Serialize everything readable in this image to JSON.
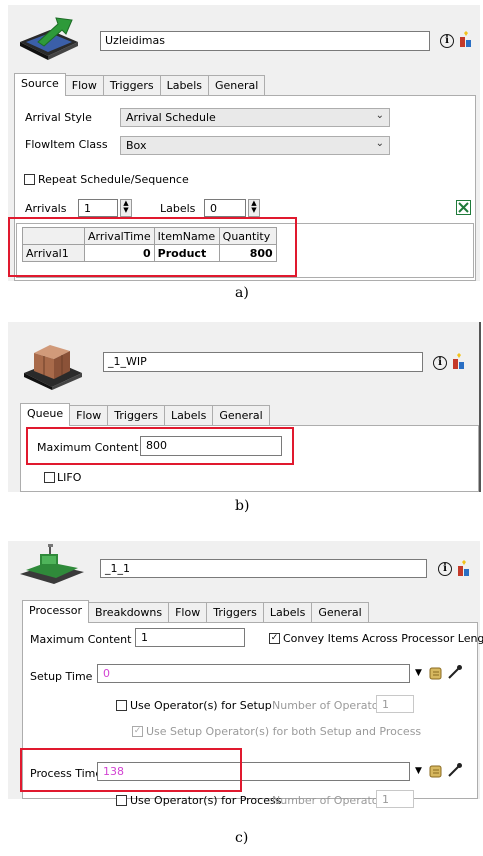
{
  "panel_a": {
    "object_name": "Uzleidimas",
    "tabs": [
      "Source",
      "Flow",
      "Triggers",
      "Labels",
      "General"
    ],
    "arrival_style_label": "Arrival Style",
    "arrival_style_value": "Arrival Schedule",
    "flowitem_class_label": "FlowItem Class",
    "flowitem_class_value": "Box",
    "repeat_label": "Repeat Schedule/Sequence",
    "arrivals_label": "Arrivals",
    "arrivals_value": "1",
    "labels_label": "Labels",
    "labels_value": "0",
    "table": {
      "columns": [
        "ArrivalTime",
        "ItemName",
        "Quantity"
      ],
      "rows": [
        {
          "name": "Arrival1",
          "time": "0",
          "item": "Product",
          "qty": "800"
        }
      ]
    },
    "caption": "a)"
  },
  "panel_b": {
    "object_name": "_1_WIP",
    "tabs": [
      "Queue",
      "Flow",
      "Triggers",
      "Labels",
      "General"
    ],
    "max_content_label": "Maximum Content",
    "max_content_value": "800",
    "lifo_label": "LIFO",
    "caption": "b)"
  },
  "panel_c": {
    "object_name": "_1_1",
    "tabs": [
      "Processor",
      "Breakdowns",
      "Flow",
      "Triggers",
      "Labels",
      "General"
    ],
    "max_content_label": "Maximum Content",
    "max_content_value": "1",
    "convey_label": "Convey Items Across Processor Length",
    "setup_time_label": "Setup Time",
    "setup_time_value": "0",
    "use_op_setup_label": "Use Operator(s) for Setup",
    "num_ops_label": "Number of Operators",
    "num_ops_setup_value": "1",
    "use_setup_op_both_label": "Use Setup Operator(s) for both Setup and Process",
    "process_time_label": "Process Time",
    "process_time_value": "138",
    "use_op_process_label": "Use Operator(s) for Process",
    "num_ops_process_value": "1",
    "caption": "c)"
  },
  "colors": {
    "highlight": "#e0192e",
    "code_text": "#d243d2"
  }
}
